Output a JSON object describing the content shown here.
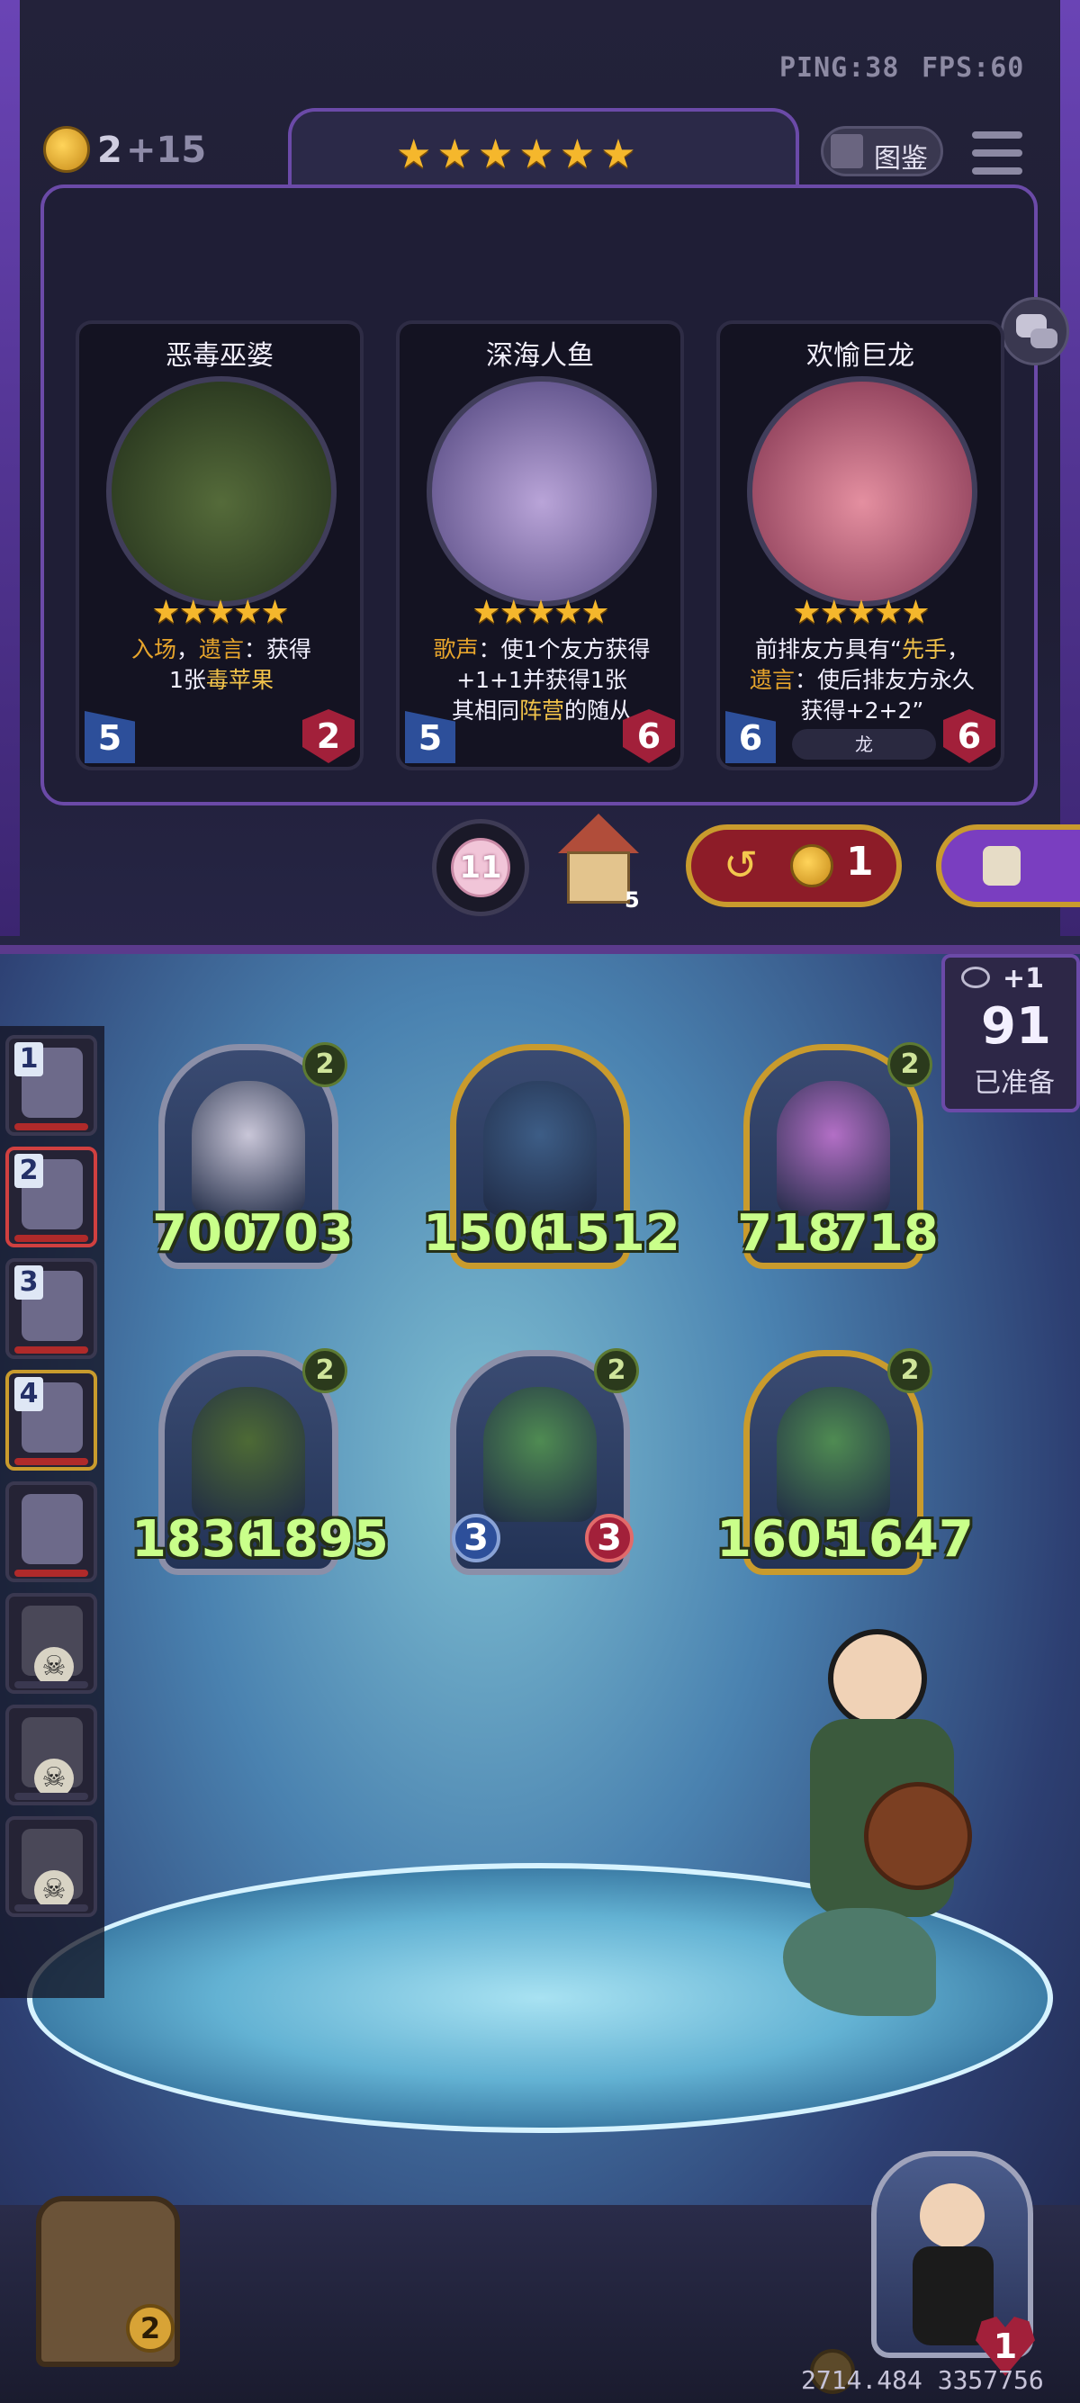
{
  "hud": {
    "ping": "PING:38",
    "fps": "FPS:60",
    "gold": "2",
    "gold_income": "+15",
    "tavern_stars": "★★★★★★",
    "codex_label": "图鉴"
  },
  "shop": {
    "cards": [
      {
        "name": "恶毒巫婆",
        "stars": "★★★★★",
        "desc_html": "<span class='kw2'>入场</span>，<span class='kw2'>遗言</span>：获得<br>1张<span class='kw'>毒苹果</span>",
        "attack": "5",
        "health": "2",
        "tribe": ""
      },
      {
        "name": "深海人鱼",
        "stars": "★★★★★",
        "desc_html": "<span class='kw2'>歌声</span>：使1个友方获得<br>+1+1并获得1张<br>其相同<span class='kw'>阵营</span>的随从",
        "attack": "5",
        "health": "6",
        "tribe": ""
      },
      {
        "name": "欢愉巨龙",
        "stars": "★★★★★",
        "desc_html": "前排友方具有“<span class='kw'>先手</span>，<br><span class='kw2'>遗言</span>：使后排友方永久<br>获得+2+2”",
        "attack": "6",
        "health": "6",
        "tribe": "龙"
      }
    ],
    "token_count": "11",
    "house_count": "5",
    "refresh_cost": "1"
  },
  "board": {
    "ready_plus": "+1",
    "ready_count": "91",
    "ready_label": "已准备",
    "minions": [
      {
        "atk": "700",
        "hp": "703",
        "level": "2",
        "frame": "silver"
      },
      {
        "atk": "1506",
        "hp": "1512",
        "level": "",
        "frame": "gold"
      },
      {
        "atk": "718",
        "hp": "718",
        "level": "2",
        "frame": "gold"
      },
      {
        "atk": "1836",
        "hp": "1895",
        "level": "2",
        "frame": "silver"
      },
      {
        "atk": "3",
        "hp": "3",
        "level": "2",
        "frame": "silver"
      },
      {
        "atk": "1605",
        "hp": "1647",
        "level": "2",
        "frame": "gold"
      }
    ],
    "side_heroes": [
      {
        "rank": "1",
        "status": "alive"
      },
      {
        "rank": "2",
        "status": "alive"
      },
      {
        "rank": "3",
        "status": "alive"
      },
      {
        "rank": "4",
        "status": "alive"
      },
      {
        "rank": "",
        "status": "alive"
      },
      {
        "rank": "",
        "status": "dead"
      },
      {
        "rank": "",
        "status": "dead"
      },
      {
        "rank": "",
        "status": "dead"
      }
    ],
    "chest_count": "2",
    "player_health": "1",
    "coords_readout": "2714.484 3357756"
  },
  "colors": {
    "star": "#f5b72c",
    "stat_text": "#c9ff8a",
    "frame_purple": "#6b4aa8",
    "attack_blue": "#2d4f9a",
    "health_red": "#a2203a"
  },
  "icons": {
    "chat": "chat-bubbles-icon",
    "menu": "hamburger-menu-icon",
    "codex": "book-icon",
    "refresh": "refresh-arrow-icon",
    "lock": "lock-icon",
    "eye": "eye-icon",
    "skull": "skull-icon"
  }
}
